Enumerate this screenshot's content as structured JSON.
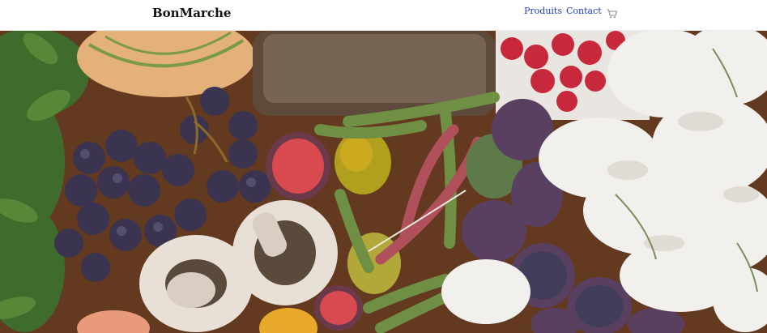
{
  "header": {
    "brand": "BonMarche",
    "nav": {
      "produits": "Produits",
      "contact": "Contact"
    },
    "cart_icon": "shopping-cart-icon"
  },
  "hero": {
    "image": "fresh-produce-flatlay",
    "colors": {
      "table": "#6b3e22",
      "grape": "#3a3450",
      "fig": "#5a4060",
      "flower": "#f2f0ec",
      "raspberry": "#c8283c",
      "bread": "#5e4a3a",
      "melon": "#e5b17a",
      "herb": "#3f6b2c",
      "bean": "#6f8f45"
    }
  },
  "theme": {
    "link": "#1f3fc9",
    "brand_text": "#111111"
  }
}
